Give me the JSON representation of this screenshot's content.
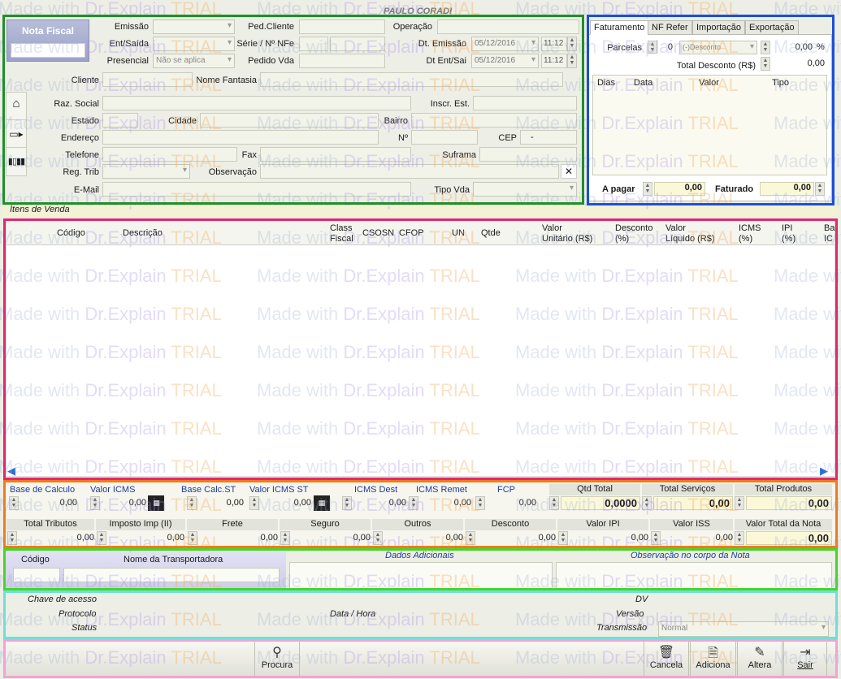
{
  "header": {
    "company": "PAULO CORADI",
    "nf_title": "Nota Fiscal"
  },
  "left_form": {
    "emissao": "Emissão",
    "ent_saida": "Ent/Saída",
    "presencial": "Presencial",
    "presencial_value": "Não se aplica",
    "ped_cliente": "Ped.Cliente",
    "serie_nfe": "Série / Nº NFe",
    "pedido_vda": "Pedido Vda",
    "operacao": "Operação",
    "dt_emissao": "Dt. Emissão",
    "dt_emissao_date": "05/12/2016",
    "dt_emissao_time": "11:12",
    "dt_ent_sai": "Dt Ent/Sai",
    "dt_ent_sai_date": "05/12/2016",
    "dt_ent_sai_time": "11:12",
    "cliente": "Cliente",
    "nome_fantasia": "Nome Fantasia",
    "raz_social": "Raz. Social",
    "inscr_est": "Inscr. Est.",
    "estado": "Estado",
    "cidade": "Cidade",
    "bairro": "Bairro",
    "endereco": "Endereço",
    "numero": "Nº",
    "cep": "CEP",
    "cep_value": "-",
    "telefone": "Telefone",
    "fax": "Fax",
    "suframa": "Suframa",
    "reg_trib": "Reg. Trib",
    "observacao": "Observação",
    "email": "E-Mail",
    "tipo_vda": "Tipo Vda",
    "clear_symbol": "✕"
  },
  "faturamento": {
    "tabs": [
      "Faturamento",
      "NF Refer",
      "Importação",
      "Exportação"
    ],
    "parcelas": "Parcelas",
    "parcelas_value": "0",
    "desconto_option": "(-)Desconto",
    "pct_value": "0,00",
    "pct_symbol": "%",
    "total_desconto": "Total Desconto (R$)",
    "total_desconto_value": "0,00",
    "columns": [
      "Dias",
      "Data",
      "Valor",
      "Tipo"
    ],
    "a_pagar": "A pagar",
    "a_pagar_value": "0,00",
    "faturado": "Faturado",
    "faturado_value": "0,00"
  },
  "itens": {
    "title": "Ítens de Venda",
    "columns": [
      {
        "l1": "Código",
        "l2": ""
      },
      {
        "l1": "Descrição",
        "l2": ""
      },
      {
        "l1": "Class",
        "l2": "Fiscal"
      },
      {
        "l1": "CSOSN",
        "l2": ""
      },
      {
        "l1": "CFOP",
        "l2": ""
      },
      {
        "l1": "UN",
        "l2": ""
      },
      {
        "l1": "Qtde",
        "l2": ""
      },
      {
        "l1": "Valor",
        "l2": "Unitário (R$)"
      },
      {
        "l1": "Desconto",
        "l2": "(%)"
      },
      {
        "l1": "Valor",
        "l2": "Líquido (R$)"
      },
      {
        "l1": "ICMS",
        "l2": "(%)"
      },
      {
        "l1": "IPI",
        "l2": "(%)"
      },
      {
        "l1": "Ba",
        "l2": "IC"
      }
    ]
  },
  "totais": {
    "row1": [
      {
        "label": "Base de Calculo",
        "value": "0,00"
      },
      {
        "label": "Valor ICMS",
        "value": "0,00"
      },
      {
        "label": "Base Calc.ST",
        "value": "0,00"
      },
      {
        "label": "Valor ICMS ST",
        "value": "0,00"
      },
      {
        "label": "ICMS Dest",
        "value": "0,00"
      },
      {
        "label": "ICMS Remet",
        "value": "0,00"
      },
      {
        "label": "FCP",
        "value": "0,00"
      }
    ],
    "qtd_total": {
      "label": "Qtd Total",
      "value": "0,0000"
    },
    "total_servicos": {
      "label": "Total Serviços",
      "value": "0,00"
    },
    "total_produtos": {
      "label": "Total Produtos",
      "value": "0,00"
    },
    "row2": [
      {
        "label": "Total Tributos",
        "value": "0,00"
      },
      {
        "label": "Imposto Imp (II)",
        "value": "0,00"
      },
      {
        "label": "Frete",
        "value": "0,00"
      },
      {
        "label": "Seguro",
        "value": "0,00"
      },
      {
        "label": "Outros",
        "value": "0,00"
      },
      {
        "label": "Desconto",
        "value": "0,00"
      },
      {
        "label": "Valor IPI",
        "value": "0,00"
      },
      {
        "label": "Valor ISS",
        "value": "0,00"
      }
    ],
    "valor_total_nota": {
      "label": "Valor Total da Nota",
      "value": "0,00"
    }
  },
  "transportadora": {
    "codigo": "Código",
    "nome": "Nome da Transportadora",
    "dados_adicionais": "Dados Adicionais",
    "obs_corpo": "Observação no corpo da Nota"
  },
  "chave": {
    "chave_acesso": "Chave de acesso",
    "dv": "DV",
    "protocolo": "Protocolo",
    "data_hora": "Data / Hora",
    "versao": "Versão",
    "status": "Status",
    "transmissao": "Transmissão",
    "transmissao_value": "Normal"
  },
  "toolbar": {
    "procura": "Procura",
    "cancela": "Cancela",
    "adiciona": "Adiciona",
    "altera": "Altera",
    "sair": "Sair"
  },
  "watermark": {
    "w1": "Made with ",
    "w2": "Dr.Explain ",
    "w3": "TRIAL"
  },
  "colors": {
    "green_frame": "#1f8f2a",
    "blue_frame": "#1c4fd8",
    "pink_frame": "#e0286e",
    "orange_frame": "#f07a1c",
    "lime_frame": "#46d62a",
    "cyan_frame": "#6fe0d6",
    "light_pink_frame": "#f4a2d6"
  }
}
